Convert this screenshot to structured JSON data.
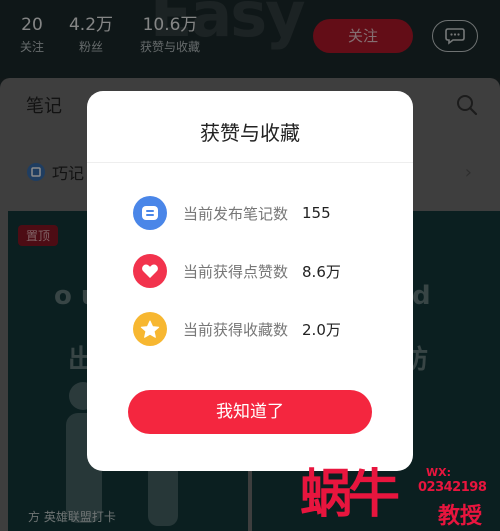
{
  "header": {
    "bg_word": "Easy",
    "stats": [
      {
        "num": "20",
        "label": "关注"
      },
      {
        "num": "4.2万",
        "label": "粉丝"
      },
      {
        "num": "10.6万",
        "label": "获赞与收藏"
      }
    ],
    "follow_label": "关注"
  },
  "content": {
    "tab_title": "笔记",
    "skill_row": "巧记",
    "left_card": {
      "pin": "置顶",
      "text1": "o u",
      "text2": "出",
      "caption": "方 英雄联盟打卡"
    },
    "right_card": {
      "text1": "d",
      "text2": "纺"
    }
  },
  "dialog": {
    "title": "获赞与收藏",
    "rows": [
      {
        "label": "当前发布笔记数",
        "value": "155",
        "icon": "note-icon"
      },
      {
        "label": "当前获得点赞数",
        "value": "8.6万",
        "icon": "heart-icon"
      },
      {
        "label": "当前获得收藏数",
        "value": "2.0万",
        "icon": "star-icon"
      }
    ],
    "ok_label": "我知道了"
  },
  "watermark": {
    "big": "蜗牛",
    "wx": "WX:",
    "num": "02342198",
    "edu": "教授"
  },
  "colors": {
    "accent": "#f4263f",
    "note_icon": "#4a86e8",
    "heart_icon": "#f2334d",
    "star_icon": "#f7b731"
  }
}
